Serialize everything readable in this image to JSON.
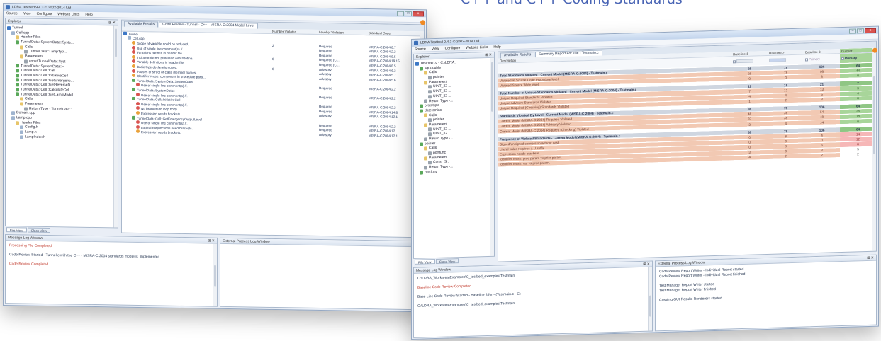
{
  "banner": "C++ and C++ Coding Standards",
  "win1": {
    "title": "LDRA Testbed 9.4.3 © 2002-2014 Ltd",
    "menu": [
      "Source",
      "View",
      "Configure",
      "Website Links",
      "Help"
    ],
    "explorer_title": "Explorer",
    "tree": [
      {
        "label": "Tunnel",
        "icon": "i-blue",
        "indent": 0
      },
      {
        "label": "Cell.cpp",
        "icon": "i-file",
        "indent": 1
      },
      {
        "label": "Header Files",
        "icon": "i-folder",
        "indent": 2
      },
      {
        "label": "TunnelData::SystemData::Syste...",
        "icon": "i-green",
        "indent": 2
      },
      {
        "label": "Calls",
        "icon": "i-folder",
        "indent": 3
      },
      {
        "label": "TunnelData::LampTyp...",
        "icon": "i-gray",
        "indent": 4
      },
      {
        "label": "Parameters",
        "icon": "i-folder",
        "indent": 3
      },
      {
        "label": "const TunnelData::Syst",
        "icon": "i-gray",
        "indent": 4
      },
      {
        "label": "TunnelData::SystemData::~",
        "icon": "i-green",
        "indent": 2
      },
      {
        "label": "TunnelData::Cell::Cell",
        "icon": "i-green",
        "indent": 2
      },
      {
        "label": "TunnelData::Cell::InitiativeCell",
        "icon": "i-green",
        "indent": 2
      },
      {
        "label": "TunnelData::Cell::GetEmergenc...",
        "icon": "i-green",
        "indent": 2
      },
      {
        "label": "TunnelData::Cell::GetReverseD...",
        "icon": "i-green",
        "indent": 2
      },
      {
        "label": "TunnelData::Cell::CalculateCell...",
        "icon": "i-green",
        "indent": 2
      },
      {
        "label": "TunnelData::Cell::GetLampModel",
        "icon": "i-green",
        "indent": 2
      },
      {
        "label": "Calls",
        "icon": "i-folder",
        "indent": 3
      },
      {
        "label": "Parameters",
        "icon": "i-folder",
        "indent": 3
      },
      {
        "label": "Return Type - TunnelData::...",
        "icon": "i-gray",
        "indent": 4
      },
      {
        "label": "Domain.cpp",
        "icon": "i-file",
        "indent": 1
      },
      {
        "label": "Lamp.cpp",
        "icon": "i-file",
        "indent": 1
      },
      {
        "label": "Header Files",
        "icon": "i-folder",
        "indent": 2
      },
      {
        "label": "Config.h",
        "icon": "i-file",
        "indent": 3
      },
      {
        "label": "Lamp.h",
        "icon": "i-file",
        "indent": 3
      },
      {
        "label": "LampIndex.h",
        "icon": "i-file",
        "indent": 3
      }
    ],
    "tabs": [
      "Available Results",
      "Code Review - Tunnel - C++ - MISRA-C:2004 Model Level"
    ],
    "columns": [
      "",
      "Number Violated",
      "Level of Violation",
      "Standard Code"
    ],
    "rows": [
      {
        "text": "Tunnel",
        "icon": "i-blue",
        "indent": 0,
        "num": "",
        "level": "",
        "code": ""
      },
      {
        "text": "Cell.cpp",
        "icon": "i-file",
        "indent": 1,
        "num": "",
        "level": "",
        "code": ""
      },
      {
        "text": "Scope of variable could be reduced.",
        "icon": "i-warn",
        "indent": 2,
        "num": "2",
        "level": "Required",
        "code": "MISRA-C:2004 8.7"
      },
      {
        "text": "Use of single line comment(s) //.",
        "icon": "i-red",
        "indent": 2,
        "num": "",
        "level": "Required",
        "code": "MISRA-C:2004 2.2"
      },
      {
        "text": "Functions defined in header file.",
        "icon": "i-red",
        "indent": 2,
        "num": "",
        "level": "Required",
        "code": "MISRA-C:2004 8.5"
      },
      {
        "text": "Included file not protected with #define.",
        "icon": "i-warn",
        "indent": 2,
        "num": "8",
        "level": "Required (C...",
        "code": "MISRA-C:2004 19.15"
      },
      {
        "text": "Variable definitions in header file.",
        "icon": "i-red",
        "indent": 2,
        "num": "",
        "level": "Required (C...",
        "code": "MISRA-C:2004 8.5"
      },
      {
        "text": "Basic type declaration used.",
        "icon": "i-warn",
        "indent": 2,
        "num": "8",
        "level": "Advisory",
        "code": "MISRA-C:2004 6.3"
      },
      {
        "text": "Pauses of struct or class member names.",
        "icon": "i-red",
        "indent": 2,
        "num": "",
        "level": "Advisory",
        "code": "MISRA-C:2004 5.7"
      },
      {
        "text": "Identifier reuse: component in procedure para...",
        "icon": "i-warn",
        "indent": 2,
        "num": "",
        "level": "Advisory",
        "code": "MISRA-C:2004 5.6"
      },
      {
        "text": "TunnelData::SystemData::SystemData",
        "icon": "i-green",
        "indent": 2,
        "num": "",
        "level": "",
        "code": ""
      },
      {
        "text": "Use of single line comment(s) //.",
        "icon": "i-red",
        "indent": 3,
        "num": "",
        "level": "Required",
        "code": "MISRA-C:2004 2.2"
      },
      {
        "text": "TunnelData::SystemData::~",
        "icon": "i-green",
        "indent": 2,
        "num": "",
        "level": "",
        "code": ""
      },
      {
        "text": "Use of single line comment(s) //.",
        "icon": "i-red",
        "indent": 3,
        "num": "",
        "level": "Required",
        "code": "MISRA-C:2004 2.2"
      },
      {
        "text": "TunnelData::Cell::InitiativeCell",
        "icon": "i-green",
        "indent": 2,
        "num": "",
        "level": "",
        "code": ""
      },
      {
        "text": "Use of single line comment(s) //.",
        "icon": "i-red",
        "indent": 3,
        "num": "",
        "level": "Required",
        "code": "MISRA-C:2004 2.2"
      },
      {
        "text": "No brackets to loop body.",
        "icon": "i-red",
        "indent": 3,
        "num": "",
        "level": "Required",
        "code": "MISRA-C:2004 14.8"
      },
      {
        "text": "Expression needs brackets.",
        "icon": "i-warn",
        "indent": 3,
        "num": "",
        "level": "Advisory",
        "code": "MISRA-C:2004 12.1"
      },
      {
        "text": "TunnelData::Cell::GetEmergencyOutputLevel",
        "icon": "i-green",
        "indent": 2,
        "num": "",
        "level": "",
        "code": ""
      },
      {
        "text": "Use of single line comment(s) //.",
        "icon": "i-red",
        "indent": 3,
        "num": "",
        "level": "Required",
        "code": "MISRA-C:2004 2.2"
      },
      {
        "text": "Logical conjunctions need brackets.",
        "icon": "i-red",
        "indent": 3,
        "num": "",
        "level": "Required",
        "code": "MISRA-C:2004 12..."
      },
      {
        "text": "Expression needs brackets.",
        "icon": "i-warn",
        "indent": 3,
        "num": "",
        "level": "Advisory",
        "code": "MISRA-C:2004 12.1"
      }
    ],
    "bottom_tabs": [
      "File View",
      "Class View"
    ],
    "log_title": "Message Log Window",
    "log_lines": [
      {
        "text": "Processing File Completed",
        "red": true
      },
      {
        "text": "Code Review Started - Tunnel.c with the C++ - MISRA-C:2004 standards model(s) implemented",
        "red": false
      },
      {
        "text": "Code Review Completed",
        "red": true
      }
    ],
    "ext_title": "External Process Log Window"
  },
  "win2": {
    "title": "LDRA Testbed 9.4.3 © 2002-2014 Ltd",
    "menu": [
      "Source",
      "View",
      "Configure",
      "Website Links",
      "Help"
    ],
    "explorer_title": "Explorer",
    "tree": [
      {
        "label": "Testmain.c - C:\\LDRA_",
        "icon": "i-blue",
        "indent": 0
      },
      {
        "label": "squdouble",
        "icon": "i-green",
        "indent": 1
      },
      {
        "label": "Calls",
        "icon": "i-folder",
        "indent": 2
      },
      {
        "label": "pointer",
        "icon": "i-gray",
        "indent": 3
      },
      {
        "label": "Parameters",
        "icon": "i-folder",
        "indent": 2
      },
      {
        "label": "UINT_32 ...",
        "icon": "i-gray",
        "indent": 3
      },
      {
        "label": "UINT_32 ...",
        "icon": "i-gray",
        "indent": 3
      },
      {
        "label": "UINT_32 ...",
        "icon": "i-gray",
        "indent": 3
      },
      {
        "label": "Return Type -...",
        "icon": "i-gray",
        "indent": 2
      },
      {
        "label": "prototype",
        "icon": "i-green",
        "indent": 1
      },
      {
        "label": "datetsmins",
        "icon": "i-green",
        "indent": 1
      },
      {
        "label": "Calls",
        "icon": "i-folder",
        "indent": 2
      },
      {
        "label": "pointer",
        "icon": "i-gray",
        "indent": 3
      },
      {
        "label": "Parameters",
        "icon": "i-folder",
        "indent": 2
      },
      {
        "label": "UINT_32 ...",
        "icon": "i-gray",
        "indent": 3
      },
      {
        "label": "UINT_32 ...",
        "icon": "i-gray",
        "indent": 3
      },
      {
        "label": "Return Type -...",
        "icon": "i-gray",
        "indent": 2
      },
      {
        "label": "pointer",
        "icon": "i-green",
        "indent": 1
      },
      {
        "label": "Calls",
        "icon": "i-folder",
        "indent": 2
      },
      {
        "label": "portfunc",
        "icon": "i-gray",
        "indent": 3
      },
      {
        "label": "Parameters",
        "icon": "i-folder",
        "indent": 2
      },
      {
        "label": "Const_S...",
        "icon": "i-gray",
        "indent": 3
      },
      {
        "label": "Return Type -...",
        "icon": "i-gray",
        "indent": 2
      },
      {
        "label": "portfunc",
        "icon": "i-green",
        "indent": 1
      }
    ],
    "tabs": [
      "Available Results",
      "Summary Report For File - Testmain.c"
    ],
    "columns": [
      "Description",
      "Baseline 1",
      "Baseline 2",
      "Baseline 3",
      "Current"
    ],
    "checkbox_labels": [
      "Primary",
      "Primary"
    ],
    "rows": [
      {
        "type": "head",
        "desc": "Total Standards Violated - Current Model (MISRA-C:2004) - Testmain.c",
        "b1": "88",
        "b2": "78",
        "b3": "106",
        "cur": "64"
      },
      {
        "type": "body",
        "desc": "Violated at Source Code Procedure level",
        "b1": "88",
        "b2": "78",
        "b3": "98",
        "cur": "44"
      },
      {
        "type": "body",
        "desc": "Violated Source Wide level",
        "b1": "0",
        "b2": "0",
        "b3": "8",
        "cur": "0"
      },
      {
        "type": "blank"
      },
      {
        "type": "head",
        "desc": "Total Number of Unique Standards Violated - Current Model (MISRA-C:2004) - Testmain.c",
        "b1": "12",
        "b2": "18",
        "b3": "21",
        "cur": "7"
      },
      {
        "type": "body",
        "desc": "Unique Required Standards Violated",
        "b1": "7",
        "b2": "12",
        "b3": "13",
        "cur": "3"
      },
      {
        "type": "body",
        "desc": "Unique Advisory Standards Violated",
        "b1": "4",
        "b2": "4",
        "b3": "5",
        "cur": "4"
      },
      {
        "type": "body",
        "desc": "Unique Required (Checking) Standards Violated",
        "b1": "1",
        "b2": "2",
        "b3": "3",
        "cur": "0"
      },
      {
        "type": "blank"
      },
      {
        "type": "head",
        "desc": "Standards Violated By Level - Current Model (MISRA-C:2004) - Testmain.c",
        "b1": "88",
        "b2": "78",
        "b3": "106",
        "cur": "64"
      },
      {
        "type": "body",
        "desc": "Current Model (MISRA-C:2004) Required Violated",
        "b1": "48",
        "b2": "36",
        "b3": "54",
        "cur": "26"
      },
      {
        "type": "body",
        "desc": "Current Model (MISRA-C:2004) Advisory Violated",
        "b1": "37",
        "b2": "38",
        "b3": "48",
        "cur": "18"
      },
      {
        "type": "body",
        "desc": "Current Model (MISRA-C:2004) Required (Checking) Violated",
        "b1": "3",
        "b2": "4",
        "b3": "14",
        "cur": "0"
      },
      {
        "type": "blank"
      },
      {
        "type": "head",
        "desc": "Frequency of Violated Standards - Current Model (MISRA-C:2004) - Testmain.c",
        "b1": "88",
        "b2": "78",
        "b3": "106",
        "cur": "64"
      },
      {
        "type": "body",
        "style": "pink",
        "desc": "Signed/unsigned conversion without cast.",
        "b1": "0",
        "b2": "8",
        "b3": "4",
        "cur": "14"
      },
      {
        "type": "body",
        "style": "pink",
        "desc": "Literal value requires a U suffix.",
        "b1": "0",
        "b2": "0",
        "b3": "0",
        "cur": "12"
      },
      {
        "type": "body",
        "style": "pink",
        "desc": "Expression needs brackets.",
        "b1": "0",
        "b2": "8",
        "b3": "6",
        "cur": "8"
      },
      {
        "type": "body",
        "style": "plain",
        "desc": "Identifier reuse: proc param vs prior param.",
        "b1": "3",
        "b2": "0",
        "b3": "3",
        "cur": "5"
      },
      {
        "type": "body",
        "style": "plain",
        "desc": "Identifier reuse: var vs proc param.",
        "b1": "4",
        "b2": "2",
        "b3": "2",
        "cur": "2"
      }
    ],
    "bottom_tabs": [
      "File View",
      "Class View"
    ],
    "log_title": "Message Log Window",
    "log_lines": [
      {
        "text": "C:\\LDRA_Workarea\\Examples\\C_testbed_examples\\Testmain",
        "red": false
      },
      {
        "text": "Baseline Code Review Completed",
        "red": true
      },
      {
        "text": "Base Line Code Review Started - Baseline 3 for - (Testmain.c - C)",
        "red": false
      },
      {
        "text": "C:\\LDRA_Workarea\\Examples\\C_testbed_examples\\Testmain",
        "red": false
      }
    ],
    "ext_title": "External Process Log Window",
    "ext_lines": [
      "Code Review Report Writer - Individual Report started",
      "Code Review Report Writer - Individual Report finished",
      "Test Manager Report Writer started",
      "Test Manager Report Writer finished",
      "Creating GUI Results Renderers started"
    ]
  }
}
